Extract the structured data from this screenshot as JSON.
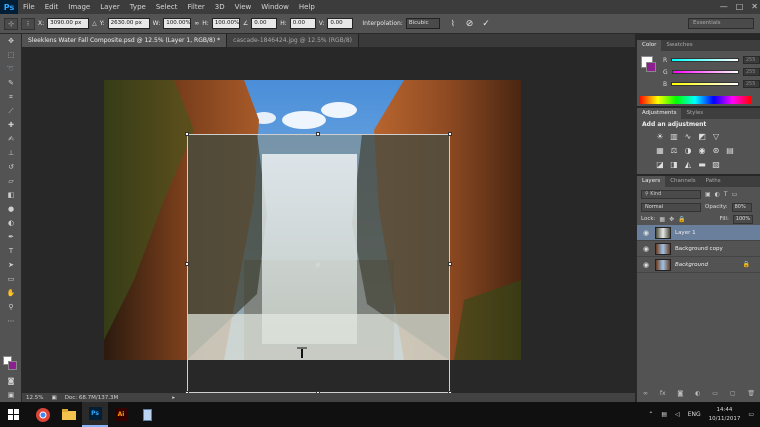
{
  "app": {
    "logo": "Ps"
  },
  "menu": [
    "File",
    "Edit",
    "Image",
    "Layer",
    "Type",
    "Select",
    "Filter",
    "3D",
    "View",
    "Window",
    "Help"
  ],
  "window_controls": [
    "—",
    "□",
    "✕"
  ],
  "options": {
    "x_label": "X:",
    "x_value": "3090.00 px",
    "y_label": "Y:",
    "y_value": "2630.00 px",
    "w_label": "W:",
    "w_value": "100.00%",
    "h_label": "H:",
    "h_value": "100.00%",
    "angle_value": "0.00",
    "hskew_label": "H:",
    "hskew_value": "0.00",
    "vskew_label": "V:",
    "vskew_value": "0.00",
    "interp_label": "Interpolation:",
    "interp_value": "Bicubic",
    "workspace": "Essentials"
  },
  "tabs": [
    {
      "label": "Sleeklens Water Fall Composite.psd @ 12.5% (Layer 1, RGB/8) *",
      "active": true
    },
    {
      "label": "cascade-1846424.jpg @ 12.5% (RGB/8)",
      "active": false
    }
  ],
  "status": {
    "zoom": "12.5%",
    "doc": "Doc: 68.7M/137.3M"
  },
  "color_panel": {
    "tabs": [
      "Color",
      "Swatches"
    ],
    "channels": [
      {
        "label": "R",
        "value": "255"
      },
      {
        "label": "G",
        "value": "255"
      },
      {
        "label": "B",
        "value": "255"
      }
    ]
  },
  "adjustments_panel": {
    "tabs": [
      "Adjustments",
      "Styles"
    ],
    "title": "Add an adjustment"
  },
  "layers_panel": {
    "tabs": [
      "Layers",
      "Channels",
      "Paths"
    ],
    "kind_label": "Kind",
    "blend_mode": "Normal",
    "opacity_label": "Opacity:",
    "opacity_value": "80%",
    "lock_label": "Lock:",
    "fill_label": "Fill:",
    "fill_value": "100%",
    "layers": [
      {
        "name": "Layer 1",
        "selected": true
      },
      {
        "name": "Background copy",
        "selected": false
      },
      {
        "name": "Background",
        "selected": false
      }
    ]
  },
  "taskbar": {
    "language": "ENG",
    "time": "14:44",
    "date": "10/11/2017"
  },
  "colors": {
    "ui_bg": "#535353",
    "selection": "#6a7f9b",
    "bg_swatch": "#8e1f8e"
  }
}
